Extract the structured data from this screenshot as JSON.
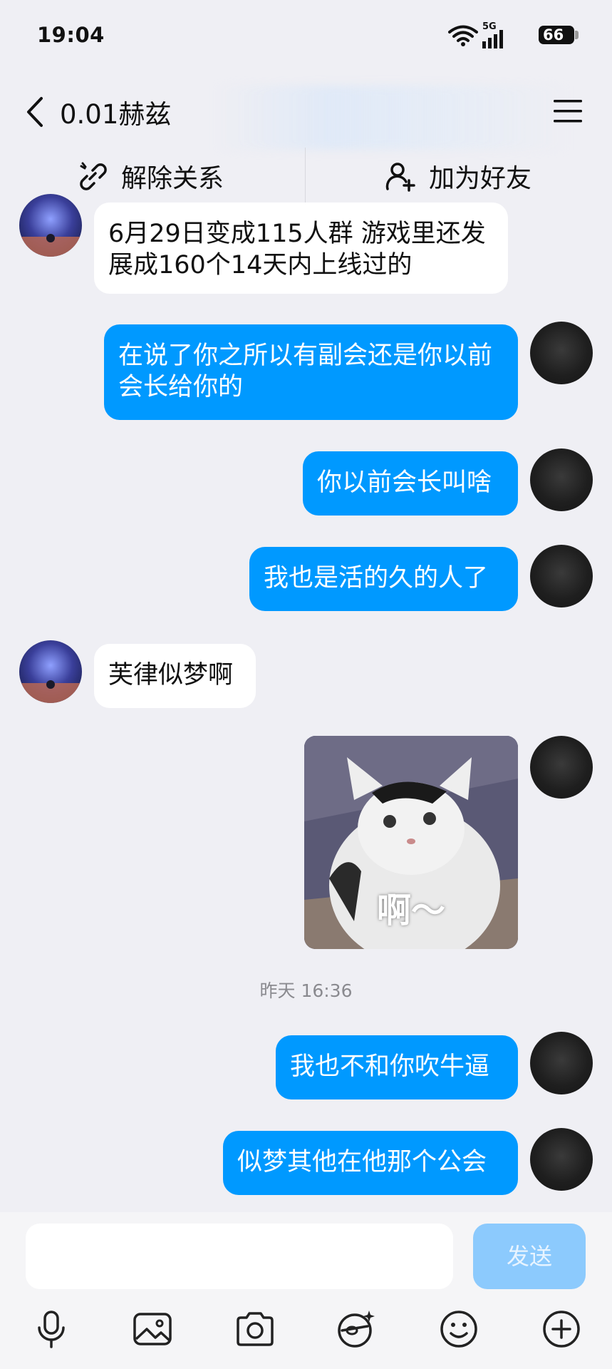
{
  "status_bar": {
    "time": "19:04",
    "network": "5G",
    "battery": "66"
  },
  "header": {
    "title": "0.01赫兹",
    "back_icon": "chevron-left-icon",
    "menu_icon": "hamburger-menu-icon"
  },
  "actions": {
    "unlink_label": "解除关系",
    "add_friend_label": "加为好友"
  },
  "messages": [
    {
      "side": "left",
      "text": "6月29日变成115人群 游戏里还发展成160个14天内上线过的"
    },
    {
      "side": "right",
      "text": "在说了你之所以有副会还是你以前会长给你的"
    },
    {
      "side": "right",
      "text": "你以前会长叫啥"
    },
    {
      "side": "right",
      "text": "我也是活的久的人了"
    },
    {
      "side": "left",
      "text": "芙律似梦啊"
    },
    {
      "side": "right",
      "type": "sticker",
      "caption": "啊～"
    },
    {
      "side": "right",
      "text": "我也不和你吹牛逼"
    },
    {
      "side": "right",
      "text": "似梦其他在他那个公会"
    }
  ],
  "timestamp": "昨天 16:36",
  "input": {
    "placeholder": "",
    "value": "",
    "send_label": "发送"
  },
  "toolbar": [
    "microphone-icon",
    "image-icon",
    "camera-icon",
    "sticker-icon",
    "emoji-icon",
    "plus-circle-icon"
  ],
  "colors": {
    "background": "#efeff4",
    "blue_bubble": "#0099ff",
    "send_disabled": "#8ccafd"
  }
}
